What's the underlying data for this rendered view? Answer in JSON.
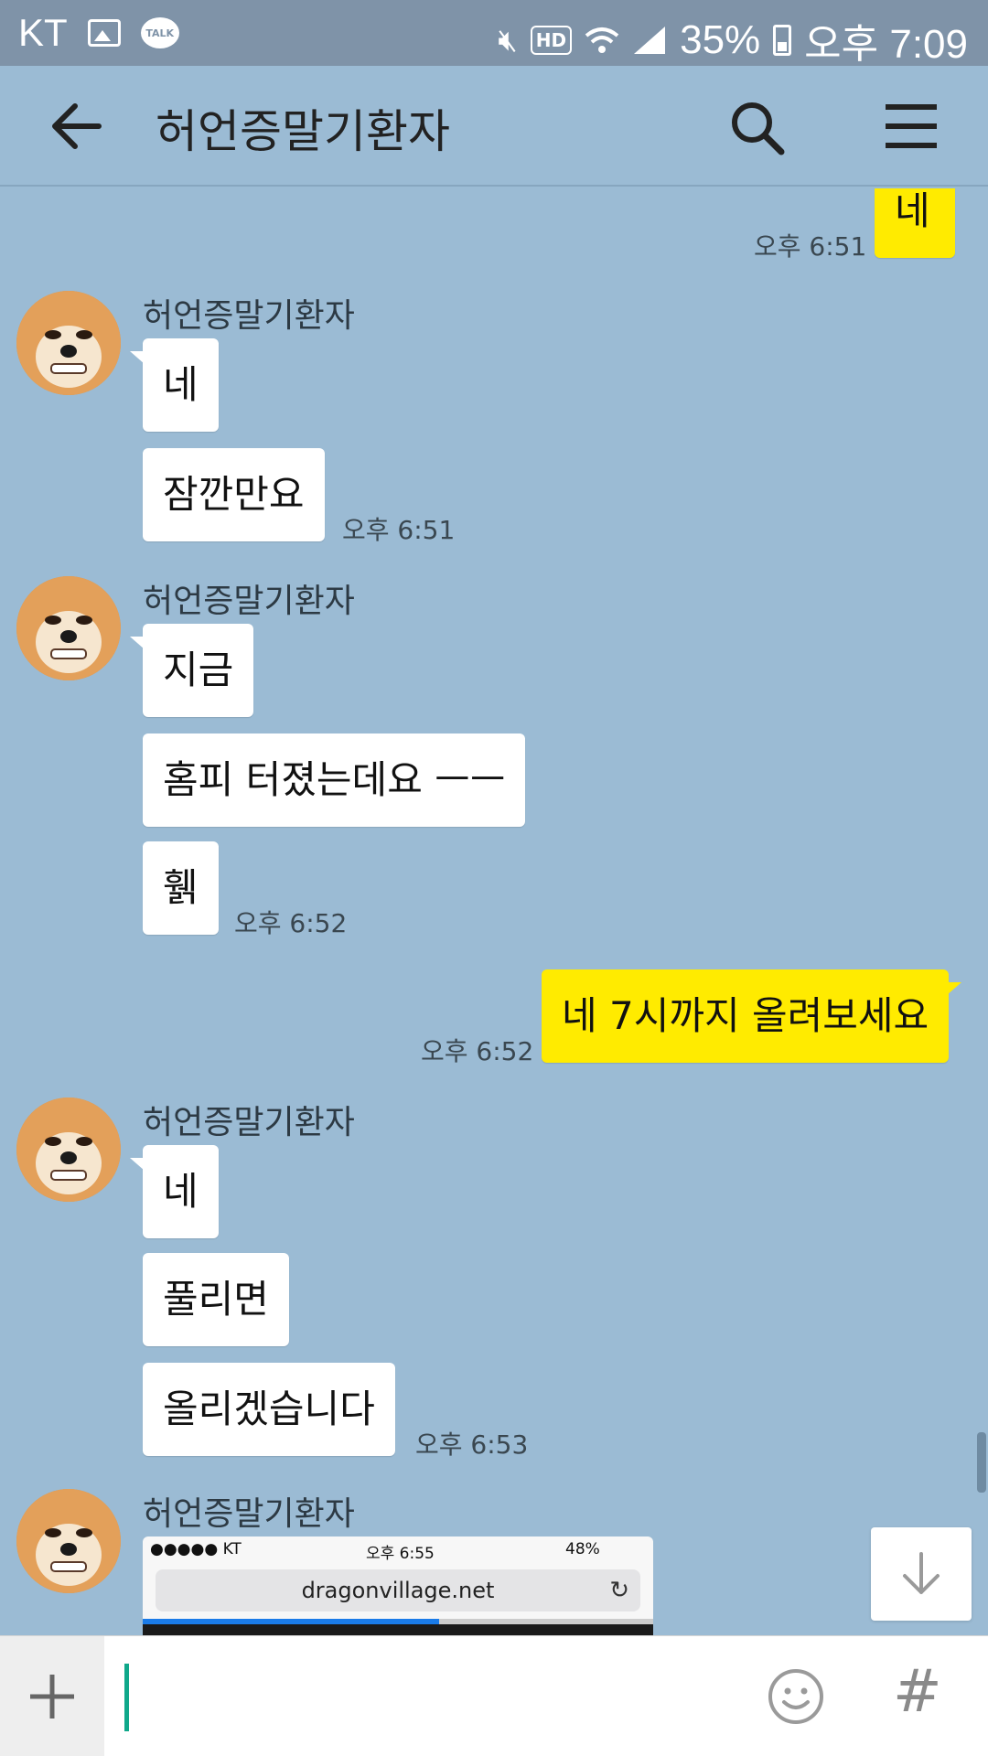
{
  "status_bar": {
    "carrier": "KT",
    "talk_badge": "TALK",
    "hd_label": "HD",
    "battery": "35%",
    "time": "오후 7:09"
  },
  "header": {
    "title": "허언증말기환자"
  },
  "messages": [
    {
      "from": "me",
      "text": "네",
      "time": "오후 6:51"
    },
    {
      "from": "other",
      "sender": "허언증말기환자",
      "texts": [
        "네",
        "잠깐만요"
      ],
      "time": "오후 6:51"
    },
    {
      "from": "other",
      "sender": "허언증말기환자",
      "texts": [
        "지금",
        "홈피 터졌는데요 ㅡㅡ",
        "휅"
      ],
      "time": "오후 6:52"
    },
    {
      "from": "me",
      "text": "네 7시까지 올려보세요",
      "time": "오후 6:52"
    },
    {
      "from": "other",
      "sender": "허언증말기환자",
      "texts": [
        "네",
        "풀리면",
        "올리겠습니다"
      ],
      "time": "오후 6:53"
    },
    {
      "from": "other",
      "sender": "허언증말기환자",
      "image": {
        "status_carrier": "●●●●● KT",
        "status_time": "오후 6:55",
        "status_battery": "48%",
        "url": "dragonvillage.net",
        "load_progress": 0.58
      }
    }
  ],
  "input": {
    "placeholder": ""
  },
  "colors": {
    "chat_bg": "#9bbbd4",
    "my_bubble": "#ffeb00",
    "caret": "#0fa88a"
  }
}
